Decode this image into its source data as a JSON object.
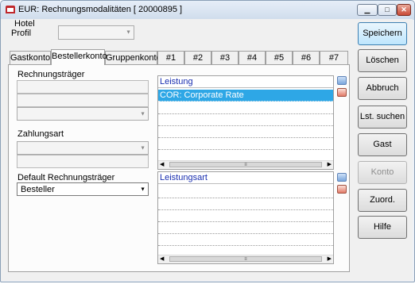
{
  "window": {
    "title": "EUR: Rechnungsmodalitäten [ 20000895 ]",
    "minimize_glyph": "▁",
    "maximize_glyph": "□",
    "close_glyph": "✕"
  },
  "header": {
    "hotel_label": "Hotel",
    "profil_label": "Profil",
    "profil_value": ""
  },
  "tabs": [
    {
      "label": "Gastkonto"
    },
    {
      "label": "Bestellerkonto",
      "active": true
    },
    {
      "label": "Gruppenkonto"
    },
    {
      "label": "#1"
    },
    {
      "label": "#2"
    },
    {
      "label": "#3"
    },
    {
      "label": "#4"
    },
    {
      "label": "#5"
    },
    {
      "label": "#6"
    },
    {
      "label": "#7"
    }
  ],
  "left": {
    "rechnungstraeger_label": "Rechnungsträger",
    "zahlungsart_label": "Zahlungsart",
    "default_label": "Default Rechnungsträger",
    "default_value": "Besteller"
  },
  "leistung": {
    "header": "Leistung",
    "rows": [
      "COR: Corporate Rate",
      "",
      "",
      "",
      "",
      ""
    ]
  },
  "leistungsart": {
    "header": "Leistungsart",
    "rows": [
      "",
      "",
      "",
      "",
      "",
      ""
    ]
  },
  "scroll": {
    "left_arrow": "◀",
    "right_arrow": "▶",
    "grip": "≡"
  },
  "buttons": {
    "speichern": "Speichern",
    "loeschen": "Löschen",
    "abbruch": "Abbruch",
    "lst_suchen": "Lst. suchen",
    "gast_suchen": "Gast suchen",
    "konto_suchen": "Konto suchen",
    "zuord_loeschen": "Zuord. löscher",
    "hilfe": "Hilfe"
  },
  "arrow_glyph": "▼"
}
